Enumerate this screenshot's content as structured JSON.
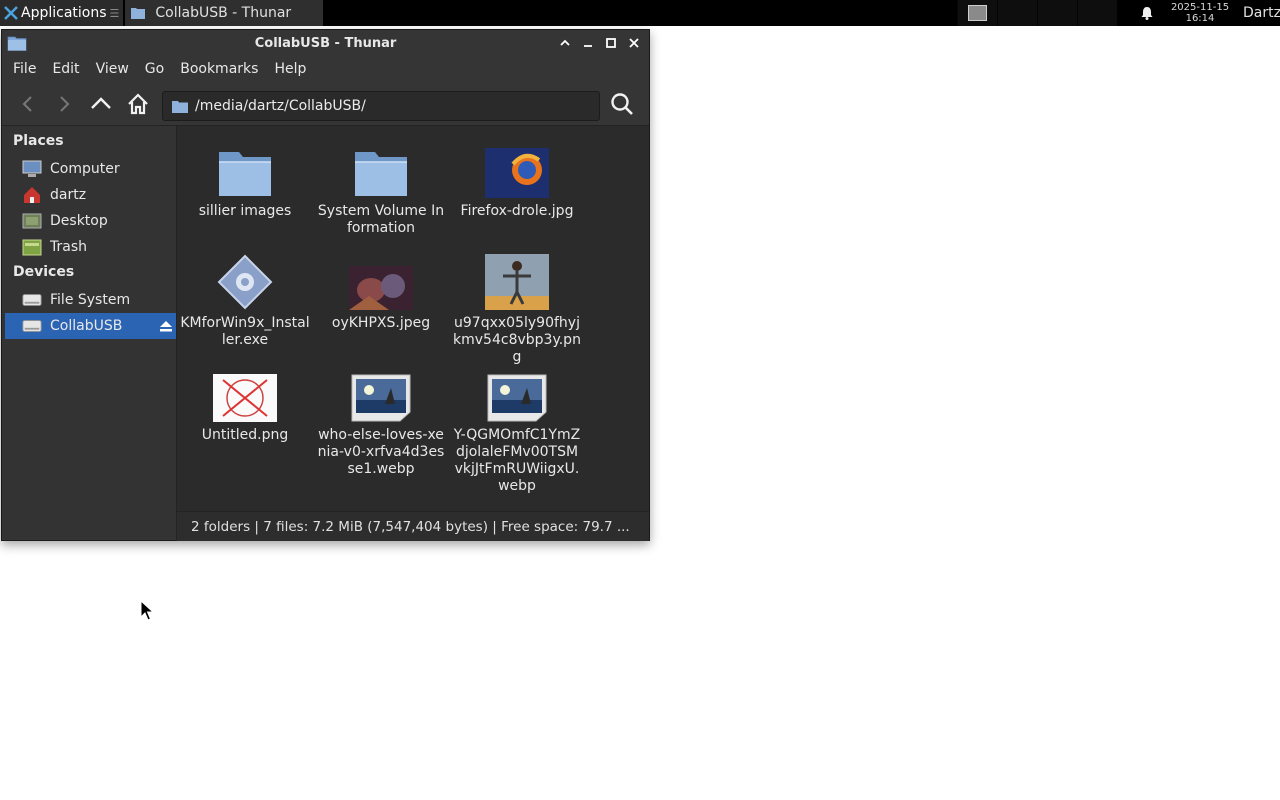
{
  "panel": {
    "apps_label": "Applications",
    "apps_suffix": "☰",
    "task_title": "CollabUSB - Thunar",
    "clock_date": "2025-11-15",
    "clock_time": "16:14",
    "user": "Dartz"
  },
  "window": {
    "title": "CollabUSB - Thunar",
    "menu": [
      "File",
      "Edit",
      "View",
      "Go",
      "Bookmarks",
      "Help"
    ],
    "location": "/media/dartz/CollabUSB/"
  },
  "sidebar": {
    "places_header": "Places",
    "places": [
      {
        "label": "Computer",
        "icon": "computer-icon"
      },
      {
        "label": "dartz",
        "icon": "home-folder-icon"
      },
      {
        "label": "Desktop",
        "icon": "desktop-icon"
      },
      {
        "label": "Trash",
        "icon": "trash-icon"
      }
    ],
    "devices_header": "Devices",
    "devices": [
      {
        "label": "File System",
        "icon": "drive-icon"
      },
      {
        "label": "CollabUSB",
        "icon": "usb-drive-icon"
      }
    ]
  },
  "files": [
    {
      "name": "sillier images",
      "type": "folder"
    },
    {
      "name": "System Volume Information",
      "type": "folder"
    },
    {
      "name": "Firefox-drole.jpg",
      "type": "image-firefox"
    },
    {
      "name": "KMforWin9x_Installer.exe",
      "type": "executable"
    },
    {
      "name": "oyKHPXS.jpeg",
      "type": "image-dark"
    },
    {
      "name": "u97qxx05ly90fhyjkmv54c8vbp3y.png",
      "type": "image-figure"
    },
    {
      "name": "Untitled.png",
      "type": "image-stamp"
    },
    {
      "name": "who-else-loves-xenia-v0-xrfva4d3esse1.webp",
      "type": "image-generic"
    },
    {
      "name": "Y-QGMOmfC1YmZdjolaleFMv00TSMvkjJtFmRUWiigxU.webp",
      "type": "image-generic"
    }
  ],
  "statusbar": {
    "text": "2 folders  |  7 files: 7.2 MiB (7,547,404 bytes)  |  Free space: 79.7 ..."
  },
  "colors": {
    "window_bg": "#353535",
    "selection": "#2c64b4",
    "folder_blue": "#7fa6d6"
  }
}
